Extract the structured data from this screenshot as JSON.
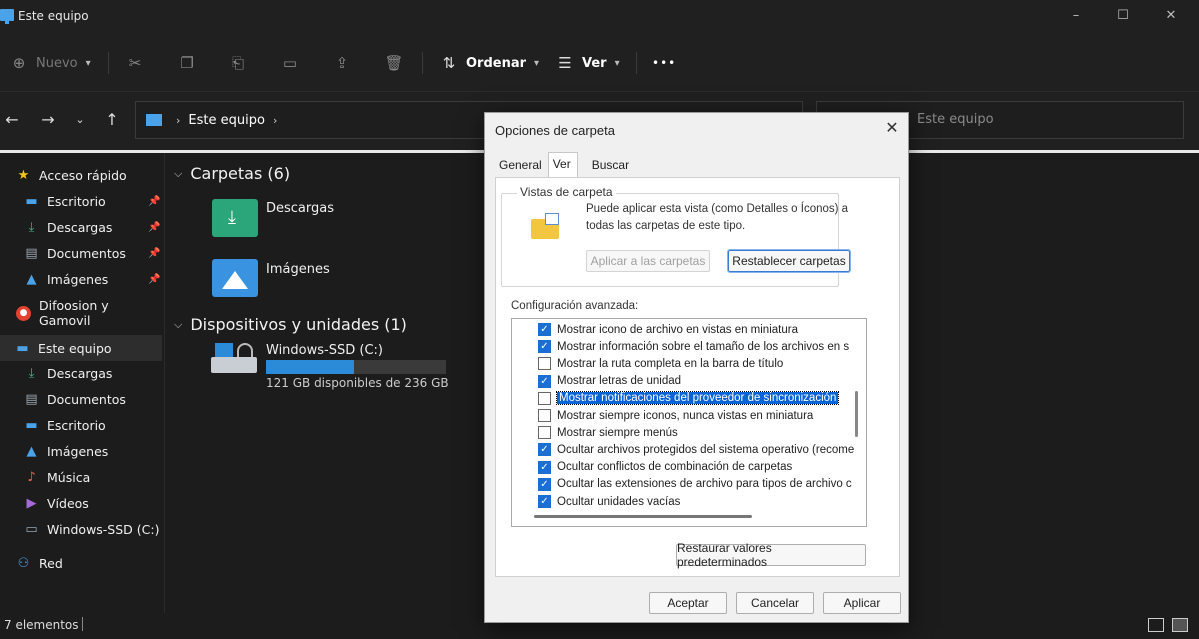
{
  "window": {
    "title": "Este equipo"
  },
  "toolbar": {
    "new_label": "Nuevo",
    "sort_label": "Ordenar",
    "view_label": "Ver",
    "more": "•••"
  },
  "address": {
    "crumb": "Este equipo",
    "search_placeholder": "Este equipo"
  },
  "sidebar": {
    "quick_access": "Acceso rápido",
    "quick_items": [
      "Escritorio",
      "Descargas",
      "Documentos",
      "Imágenes"
    ],
    "user": "Difoosion y Gamovil",
    "this_pc": "Este equipo",
    "pc_items": [
      "Descargas",
      "Documentos",
      "Escritorio",
      "Imágenes",
      "Música",
      "Vídeos",
      "Windows-SSD (C:)"
    ],
    "network": "Red"
  },
  "main": {
    "folders_header": "Carpetas (6)",
    "folders": [
      "Descargas",
      "Imágenes"
    ],
    "devices_header": "Dispositivos y unidades (1)",
    "drive_name": "Windows-SSD (C:)",
    "drive_free": "121 GB disponibles de 236 GB",
    "drive_used_fraction": 0.49
  },
  "status": {
    "count": "7 elementos"
  },
  "dialog": {
    "title": "Opciones de carpeta",
    "tabs": [
      "General",
      "Ver",
      "Buscar"
    ],
    "selected_tab": "Ver",
    "folder_views_legend": "Vistas de carpeta",
    "folder_views_text": "Puede aplicar esta vista (como Detalles o Íconos) a todas las carpetas de este tipo.",
    "apply_button": "Aplicar a las carpetas",
    "reset_folders_button": "Restablecer carpetas",
    "advanced_label": "Configuración avanzada:",
    "advanced_items": [
      {
        "label": "Mostrar icono de archivo en vistas en miniatura",
        "checked": true
      },
      {
        "label": "Mostrar información sobre el tamaño de los archivos en s",
        "checked": true
      },
      {
        "label": "Mostrar la ruta completa en la barra de título",
        "checked": false
      },
      {
        "label": "Mostrar letras de unidad",
        "checked": true
      },
      {
        "label": "Mostrar notificaciones del proveedor de sincronización",
        "checked": false,
        "selected": true
      },
      {
        "label": "Mostrar siempre iconos, nunca vistas en miniatura",
        "checked": false
      },
      {
        "label": "Mostrar siempre menús",
        "checked": false
      },
      {
        "label": "Ocultar archivos protegidos del sistema operativo (recome",
        "checked": true
      },
      {
        "label": "Ocultar conflictos de combinación de carpetas",
        "checked": true
      },
      {
        "label": "Ocultar las extensiones de archivo para tipos de archivo c",
        "checked": true
      },
      {
        "label": "Ocultar unidades vacías",
        "checked": true
      }
    ],
    "restore_defaults_button": "Restaurar valores predeterminados",
    "ok_button": "Aceptar",
    "cancel_button": "Cancelar",
    "apply_footer_button": "Aplicar"
  },
  "colors": {
    "accent": "#1a6fd4",
    "explorer_bg": "#1c1c1c",
    "dialog_bg": "#f0f0f0"
  }
}
